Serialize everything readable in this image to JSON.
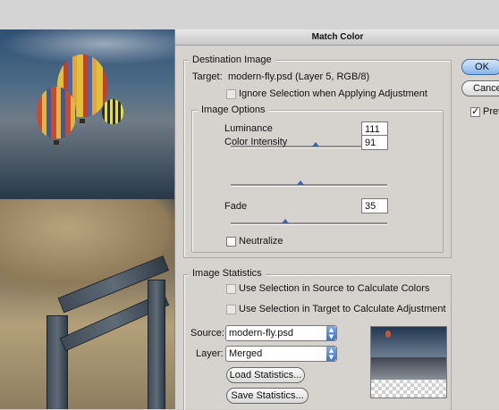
{
  "dialog": {
    "title": "Match Color",
    "destination": {
      "legend": "Destination Image",
      "target_label": "Target:",
      "target_value": "modern-fly.psd (Layer 5, RGB/8)",
      "ignore_selection_label": "Ignore Selection when Applying Adjustment",
      "image_options": {
        "legend": "Image Options",
        "luminance_label": "Luminance",
        "luminance_value": "111",
        "color_intensity_label": "Color Intensity",
        "color_intensity_value": "91",
        "fade_label": "Fade",
        "fade_value": "35",
        "neutralize_label": "Neutralize"
      }
    },
    "statistics": {
      "legend": "Image Statistics",
      "use_source_label": "Use Selection in Source to Calculate Colors",
      "use_target_label": "Use Selection in Target to Calculate Adjustment",
      "source_label": "Source:",
      "source_value": "modern-fly.psd",
      "layer_label": "Layer:",
      "layer_value": "Merged",
      "load_label": "Load Statistics...",
      "save_label": "Save Statistics..."
    },
    "buttons": {
      "ok": "OK",
      "cancel": "Cancel",
      "preview": "Preview"
    }
  },
  "slider_levels": {
    "luminance": 111,
    "color_intensity": 91,
    "fade": 35
  },
  "colors": {
    "accent": "#3e66a6",
    "dialog_bg": "#d6d3ce"
  }
}
